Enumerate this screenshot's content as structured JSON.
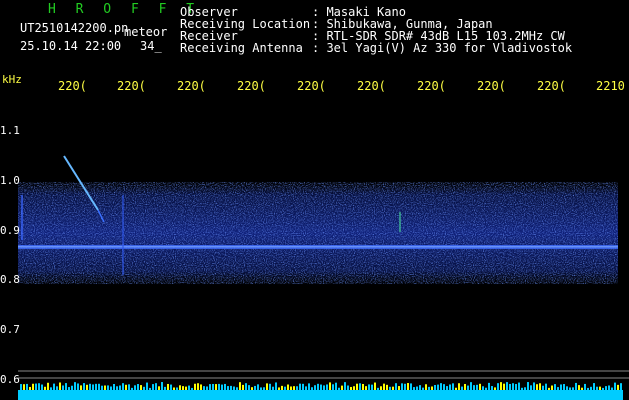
{
  "header": {
    "brand": "H R O F F T",
    "filename": "UT2510142200.pn",
    "tag": "meteor",
    "datetime": "25.10.14 22:00",
    "partial": "34_",
    "info": [
      {
        "label": "Observer",
        "value": ": Masaki Kano"
      },
      {
        "label": "Receiving Location",
        "value": ": Shibukawa, Gunma, Japan"
      },
      {
        "label": "Receiver",
        "value": ": RTL-SDR SDR# 43dB L15 103.2MHz CW"
      },
      {
        "label": "Receiving Antenna",
        "value": ": 3el Yagi(V) Az 330 for Vladivostok"
      }
    ]
  },
  "axis": {
    "unit": "kHz",
    "x_ticks": [
      "220(",
      "220(",
      "220(",
      "220(",
      "220(",
      "220(",
      "220(",
      "220(",
      "220(",
      "2210"
    ],
    "y_ticks": [
      "1.1",
      "1.0",
      "0.9",
      "0.8",
      "0.7",
      "0.6"
    ]
  },
  "colors": {
    "background": "#000000",
    "brand": "#22cc22",
    "text": "#ffffff",
    "axis_text": "#ffff44",
    "signal": "#3355ff",
    "signal_bright": "#99ccff",
    "level": "#00ccff",
    "level_spike": "#ffff00",
    "ref_line": "#888888"
  }
}
